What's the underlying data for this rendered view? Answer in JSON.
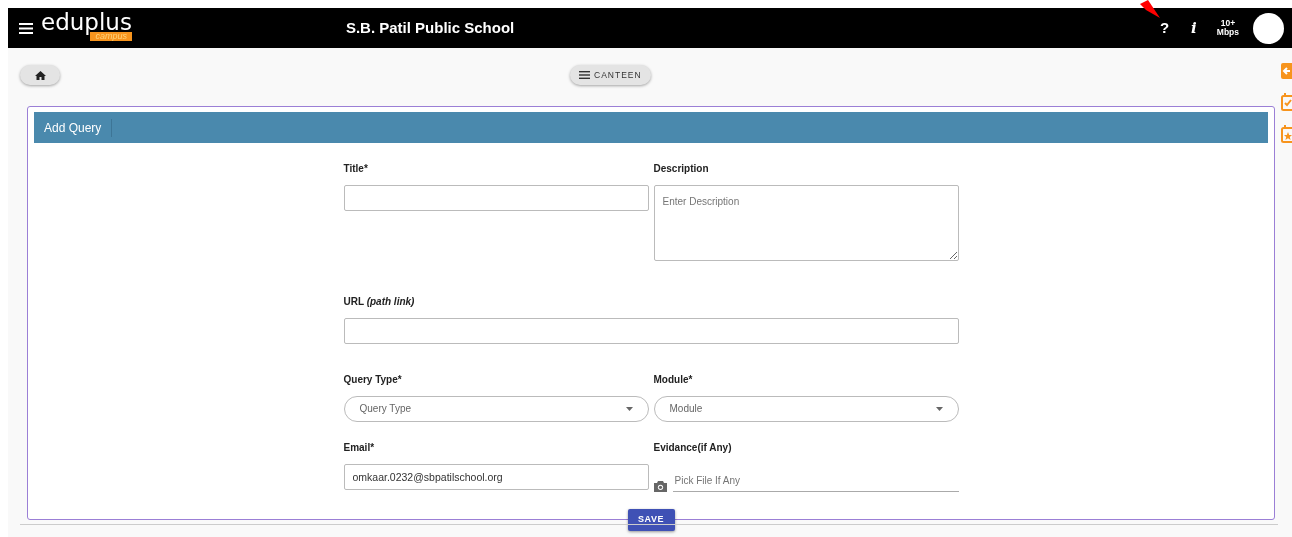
{
  "header": {
    "logo_text": "eduplus",
    "logo_sub": "campus",
    "school": "S.B. Patil Public School",
    "help": "?",
    "info": "i",
    "speed_top": "10+",
    "speed_bottom": "Mbps"
  },
  "toolbar": {
    "module_button": "CANTEEN"
  },
  "form": {
    "title": "Add Query",
    "rows": [
      [
        {
          "kind": "input",
          "label": "Title*"
        },
        {
          "kind": "textarea",
          "label": "Description",
          "placeholder": "Enter Description"
        }
      ],
      [
        {
          "kind": "input",
          "label": "URL *(path link)*"
        }
      ],
      [
        {
          "kind": "select",
          "label": "Query Type*",
          "placeholder": "Query Type"
        },
        {
          "kind": "select",
          "label": "Module*",
          "placeholder": "Module"
        }
      ],
      [
        {
          "kind": "input",
          "label": "Email*",
          "value": "omkaar.0232@sbpatilschool.org"
        },
        {
          "kind": "file",
          "label": "Evidance(if Any)",
          "placeholder": "Pick File If Any"
        }
      ]
    ],
    "save": "SAVE"
  }
}
